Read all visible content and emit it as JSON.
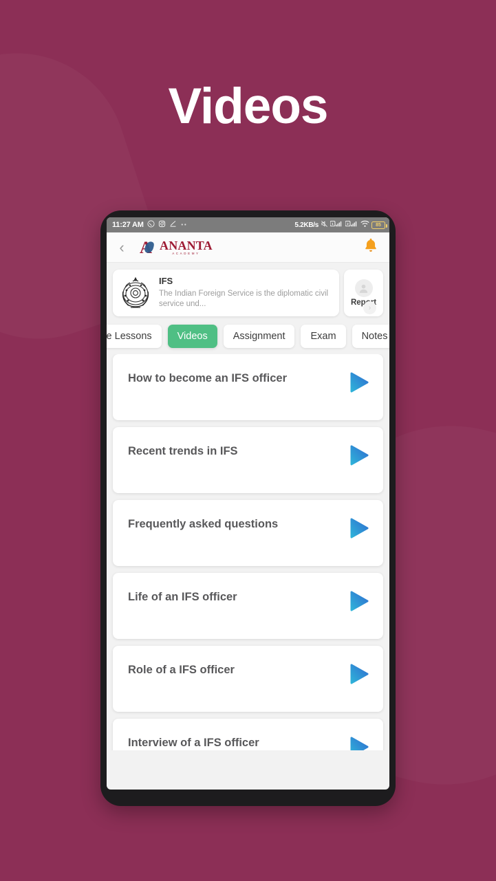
{
  "hero": {
    "title": "Videos",
    "background_color": "#8C2F56"
  },
  "status_bar": {
    "time": "11:27 AM",
    "icons": [
      "whatsapp-icon",
      "instagram-icon",
      "download-icon",
      "more-dots-icon"
    ],
    "network_speed": "5.2KB/s",
    "right_icons": [
      "mute-icon",
      "sim1-signal-icon",
      "sim2-signal-icon",
      "wifi-icon"
    ],
    "battery_level": "85"
  },
  "app_header": {
    "back_label": "‹",
    "brand_letter": "A",
    "brand_name": "ANANTA",
    "brand_sub": "ACADEMY",
    "bell_color": "#F5A01E"
  },
  "course": {
    "emblem_name": "ifs-emblem-icon",
    "title": "IFS",
    "description": "The Indian Foreign Service is the diplomatic civil service und...",
    "report_label": "Report",
    "chevron_label": "›"
  },
  "tabs": [
    {
      "label": "Live Lessons",
      "active": false
    },
    {
      "label": "Videos",
      "active": true
    },
    {
      "label": "Assignment",
      "active": false
    },
    {
      "label": "Exam",
      "active": false
    },
    {
      "label": "Notes",
      "active": false
    }
  ],
  "active_tab_color": "#4FBF84",
  "videos": [
    {
      "title": "How to become an IFS officer"
    },
    {
      "title": "Recent trends in IFS"
    },
    {
      "title": "Frequently asked questions"
    },
    {
      "title": "Life of an IFS officer"
    },
    {
      "title": "Role of a IFS officer"
    },
    {
      "title": "Interview of a IFS officer"
    }
  ],
  "play_button": {
    "gradient_from": "#2FB3D9",
    "gradient_to": "#2F6FD0"
  }
}
